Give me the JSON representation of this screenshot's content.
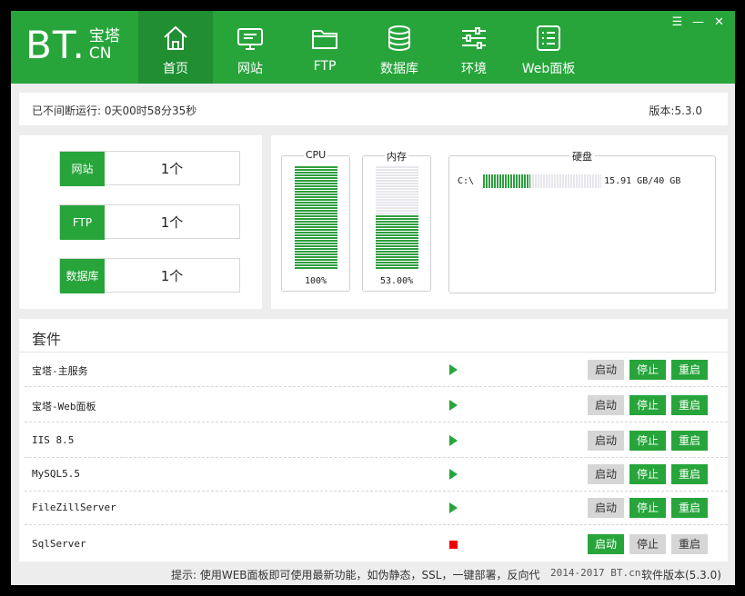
{
  "logo": {
    "bt": "BT.",
    "cn_top": "宝塔",
    "cn_bottom": "CN"
  },
  "nav": [
    {
      "label": "首页",
      "icon": "home-icon",
      "active": true
    },
    {
      "label": "网站",
      "icon": "monitor-icon"
    },
    {
      "label": "FTP",
      "icon": "folder-icon"
    },
    {
      "label": "数据库",
      "icon": "database-icon"
    },
    {
      "label": "环境",
      "icon": "sliders-icon"
    },
    {
      "label": "Web面板",
      "icon": "panel-list-icon"
    }
  ],
  "window_controls": {
    "menu": "☰",
    "minimize": "—",
    "close": "✕"
  },
  "status": {
    "uptime": "已不间断运行: 0天00时58分35秒",
    "version": "版本:5.3.0"
  },
  "counts": [
    {
      "label": "网站",
      "value": "1个"
    },
    {
      "label": "FTP",
      "value": "1个"
    },
    {
      "label": "数据库",
      "value": "1个"
    }
  ],
  "resources": {
    "cpu": {
      "title": "CPU",
      "value_text": "100%",
      "percent": 100
    },
    "memory": {
      "title": "内存",
      "value_text": "53.00%",
      "percent": 53
    },
    "disk": {
      "title": "硬盘",
      "drive": "C:\\",
      "usage_text": "15.91 GB/40 GB",
      "fraction": 0.398
    }
  },
  "suite": {
    "title": "套件",
    "services": [
      {
        "name": "宝塔-主服务",
        "status": "running"
      },
      {
        "name": "宝塔-Web面板",
        "status": "running"
      },
      {
        "name": "IIS 8.5",
        "status": "running"
      },
      {
        "name": "MySQL5.5",
        "status": "running"
      },
      {
        "name": "FileZillServer",
        "status": "running"
      },
      {
        "name": "SqlServer",
        "status": "stopped"
      }
    ],
    "buttons": {
      "start": "启动",
      "stop": "停止",
      "restart": "重启"
    }
  },
  "footer": {
    "tip": "提示: 使用WEB面板即可使用最新功能，如伪静态，SSL，一键部署，反向代",
    "copyright": "2014-2017 BT.cn",
    "software_version": "软件版本(5.3.0)"
  },
  "colors": {
    "primary": "#27a53b",
    "active_nav": "#1f8f31",
    "stopped": "#ee0000"
  }
}
